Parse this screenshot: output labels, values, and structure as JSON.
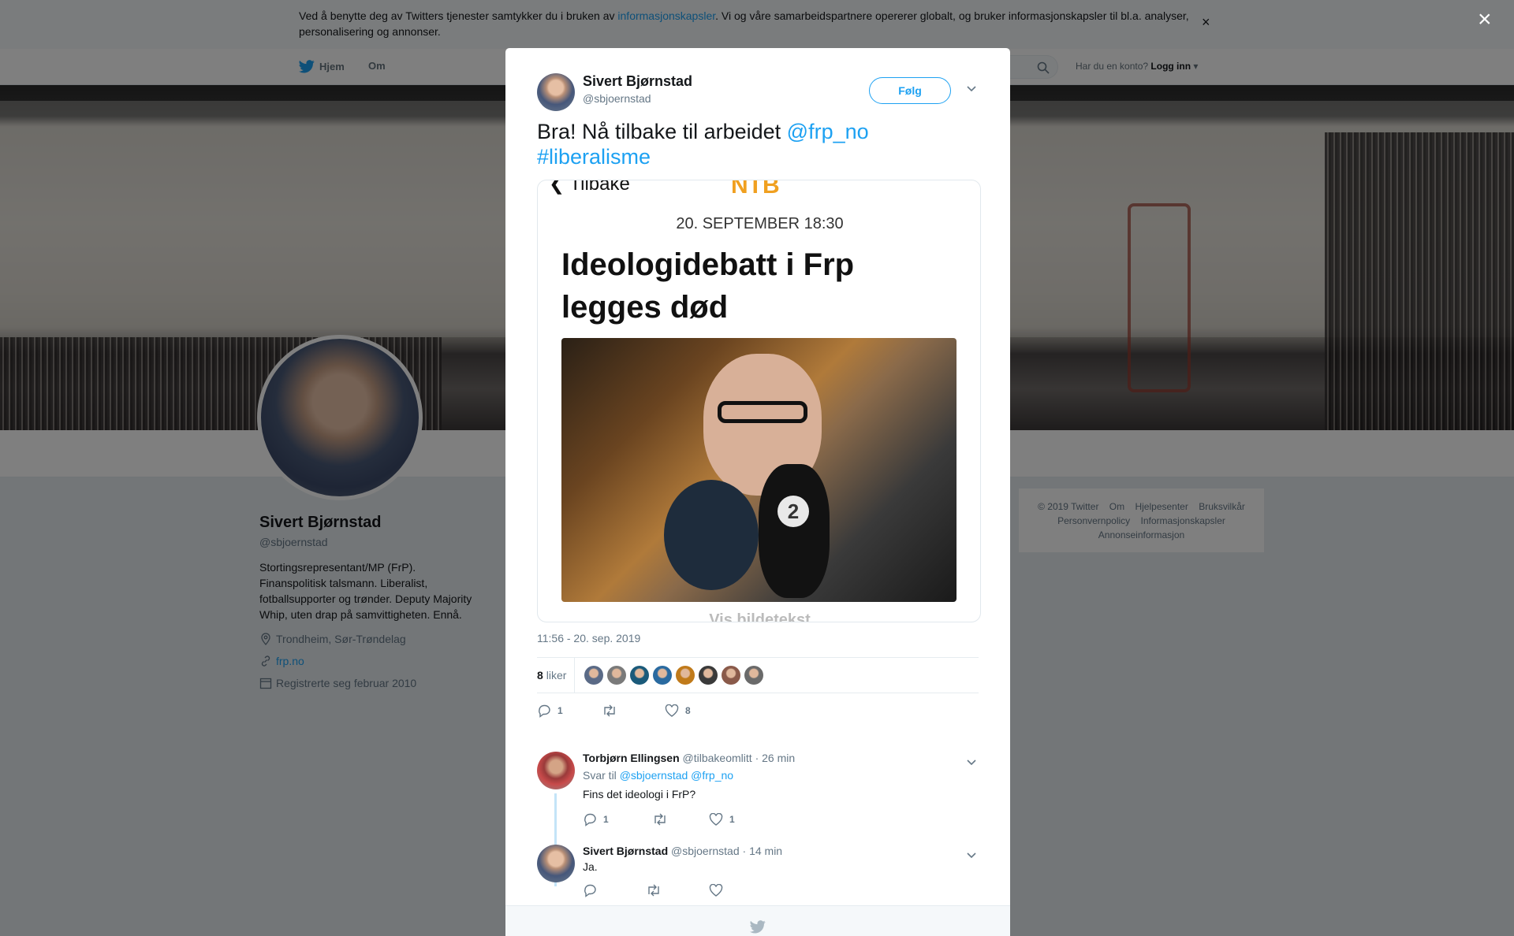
{
  "cookie": {
    "text_before": "Ved å benytte deg av Twitters tjenester samtykker du i bruken av ",
    "link": "informasjonskapsler",
    "text_after": ". Vi og våre samarbeidspartnere opererer globalt, og bruker informasjonskapsler til bl.a. analyser, personalisering og annonser.",
    "close": "×"
  },
  "nav": {
    "home": "Hjem",
    "about": "Om",
    "login_prompt": "Har du en konto?",
    "login": "Logg inn"
  },
  "profile": {
    "name": "Sivert Bjørnstad",
    "handle": "@sbjoernstad",
    "bio": "Stortingsrepresentant/MP (FrP). Finanspolitisk talsmann. Liberalist, fotballsupporter og trønder. Deputy Majority Whip, uten drap på samvittigheten. Ennå.",
    "location": "Trondheim, Sør-Trøndelag",
    "website": "frp.no",
    "joined": "Registrerte seg februar 2010"
  },
  "footer": {
    "items": [
      "© 2019 Twitter",
      "Om",
      "Hjelpesenter",
      "Bruksvilkår",
      "Personvernpolicy",
      "Informasjonskapsler",
      "Annonseinformasjon"
    ]
  },
  "overlay_close": "×",
  "tweet": {
    "name": "Sivert Bjørnstad",
    "handle": "@sbjoernstad",
    "follow": "Følg",
    "text": "Bra! Nå tilbake til arbeidet ",
    "mention": "@frp_no",
    "hashtag": "#liberalisme",
    "timestamp": "11:56 - 20. sep. 2019",
    "likes_num": "8",
    "likes_word": "liker",
    "reply_count": "1",
    "retweet_count": "",
    "like_count": "8",
    "liker_colors": [
      "#5a6a86",
      "#7a7a7a",
      "#1a5a7a",
      "#2a6aa0",
      "#c07a1a",
      "#3a3a3a",
      "#8a5a4a",
      "#6a6a6a"
    ]
  },
  "media": {
    "back": "❮ Tilbake",
    "logo": "NTB",
    "date": "20. SEPTEMBER 18:30",
    "headline": "Ideologidebatt i Frp legges død",
    "mic_label": "2",
    "caption": "Vis bildetekst"
  },
  "replies": [
    {
      "name": "Torbjørn Ellingsen",
      "handle": "@tilbakeomlitt",
      "time": "· 26 min",
      "reply_to_label": "Svar til",
      "reply_to_1": "@sbjoernstad",
      "reply_to_2": "@frp_no",
      "text": "Fins det ideologi i FrP?",
      "reply_count": "1",
      "like_count": "1"
    },
    {
      "name": "Sivert Bjørnstad",
      "handle": "@sbjoernstad",
      "time": "· 14 min",
      "text": "Ja."
    }
  ]
}
